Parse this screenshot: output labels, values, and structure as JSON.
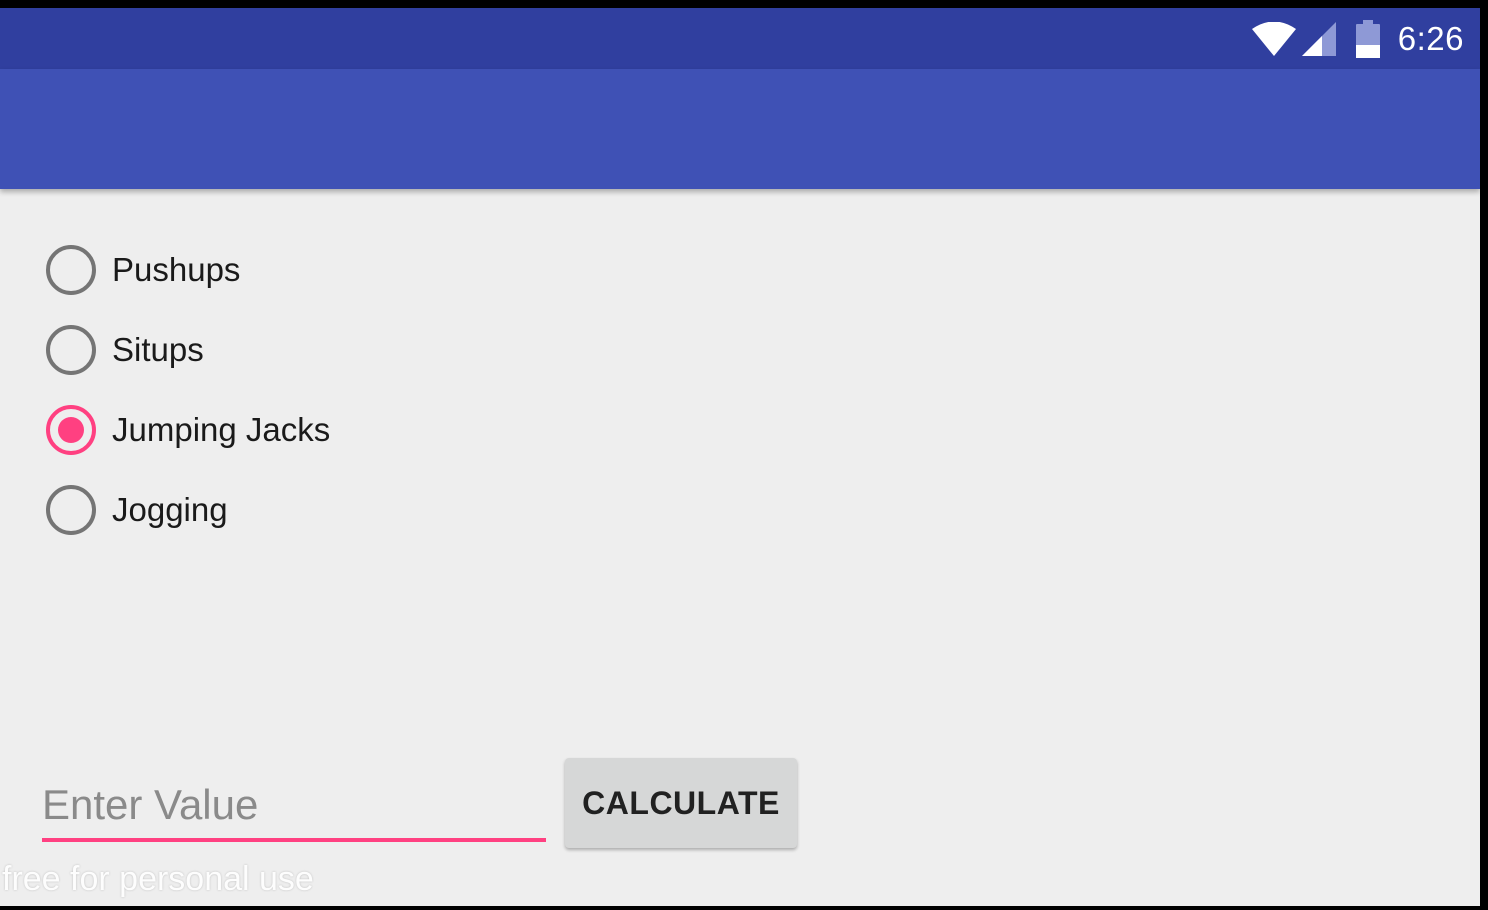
{
  "status_bar": {
    "time": "6:26",
    "icons": [
      "wifi-icon",
      "cell-signal-icon",
      "battery-icon"
    ]
  },
  "exercise_options": [
    {
      "label": "Pushups",
      "checked": false
    },
    {
      "label": "Situps",
      "checked": false
    },
    {
      "label": "Jumping Jacks",
      "checked": true
    },
    {
      "label": "Jogging",
      "checked": false
    }
  ],
  "value_input": {
    "placeholder": "Enter Value",
    "value": ""
  },
  "calculate_button": {
    "label": "CALCULATE"
  },
  "watermark": "free for personal use",
  "colors": {
    "status_bar": "#303f9f",
    "app_bar": "#3f51b5",
    "accent": "#ff4081",
    "background": "#eeeeee",
    "button": "#d6d7d7"
  }
}
